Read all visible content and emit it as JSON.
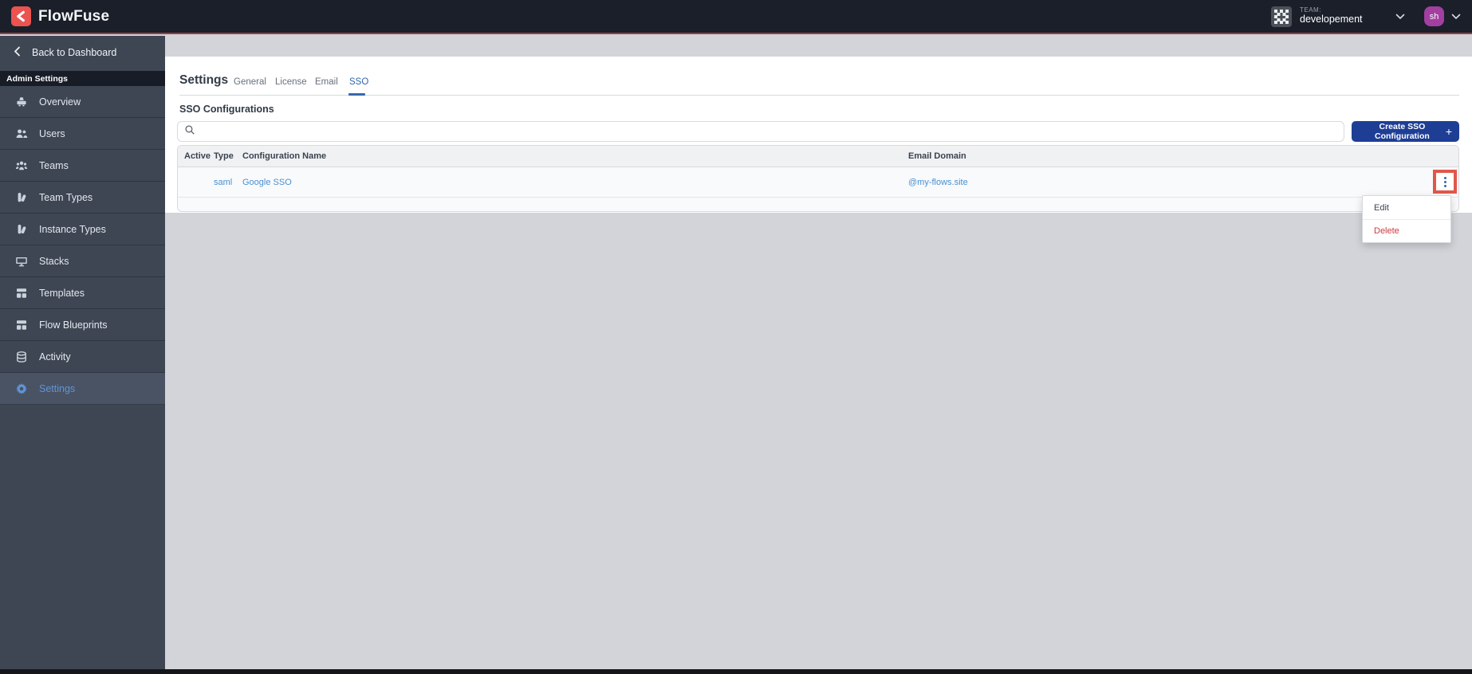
{
  "navbar": {
    "brand": "FlowFuse",
    "team": {
      "label": "TEAM:",
      "name": "developement"
    },
    "avatar": {
      "initials": "sh"
    }
  },
  "sidebar": {
    "back_label": "Back to Dashboard",
    "section_label": "Admin Settings",
    "items": [
      {
        "label": "Overview",
        "icon": "scale-icon"
      },
      {
        "label": "Users",
        "icon": "users-icon"
      },
      {
        "label": "Teams",
        "icon": "user-group-icon"
      },
      {
        "label": "Team Types",
        "icon": "swatch-icon"
      },
      {
        "label": "Instance Types",
        "icon": "swatch-icon"
      },
      {
        "label": "Stacks",
        "icon": "desktop-icon"
      },
      {
        "label": "Templates",
        "icon": "template-icon"
      },
      {
        "label": "Flow Blueprints",
        "icon": "template-icon"
      },
      {
        "label": "Activity",
        "icon": "database-icon"
      },
      {
        "label": "Settings",
        "icon": "gear-icon",
        "active": true
      }
    ]
  },
  "main": {
    "title": "Settings",
    "tabs": [
      {
        "label": "General",
        "active": false
      },
      {
        "label": "License",
        "active": false
      },
      {
        "label": "Email",
        "active": false
      },
      {
        "label": "SSO",
        "active": true
      }
    ],
    "section_title": "SSO Configurations",
    "search": {
      "placeholder": ""
    },
    "create_button": {
      "label": "Create SSO Configuration",
      "plus": "+"
    },
    "table": {
      "columns": [
        "Active",
        "Type",
        "Configuration Name",
        "Email Domain"
      ],
      "rows": [
        {
          "active": "",
          "type": "saml",
          "name": "Google SSO",
          "email_domain": "@my-flows.site"
        }
      ]
    },
    "context_menu": {
      "items": [
        {
          "label": "Edit",
          "danger": false
        },
        {
          "label": "Delete",
          "danger": true
        }
      ]
    }
  },
  "colors": {
    "brand_red": "#ea5350",
    "navbar_bg": "#1a1f2a",
    "sidebar_bg": "#3e4654",
    "button_navy": "#1e3e96",
    "link_blue": "#478fd3",
    "active_blue": "#5f94d6",
    "danger_red": "#ce3a40",
    "annotation_red": "#e0584a",
    "page_bg": "#d2d4d9"
  }
}
